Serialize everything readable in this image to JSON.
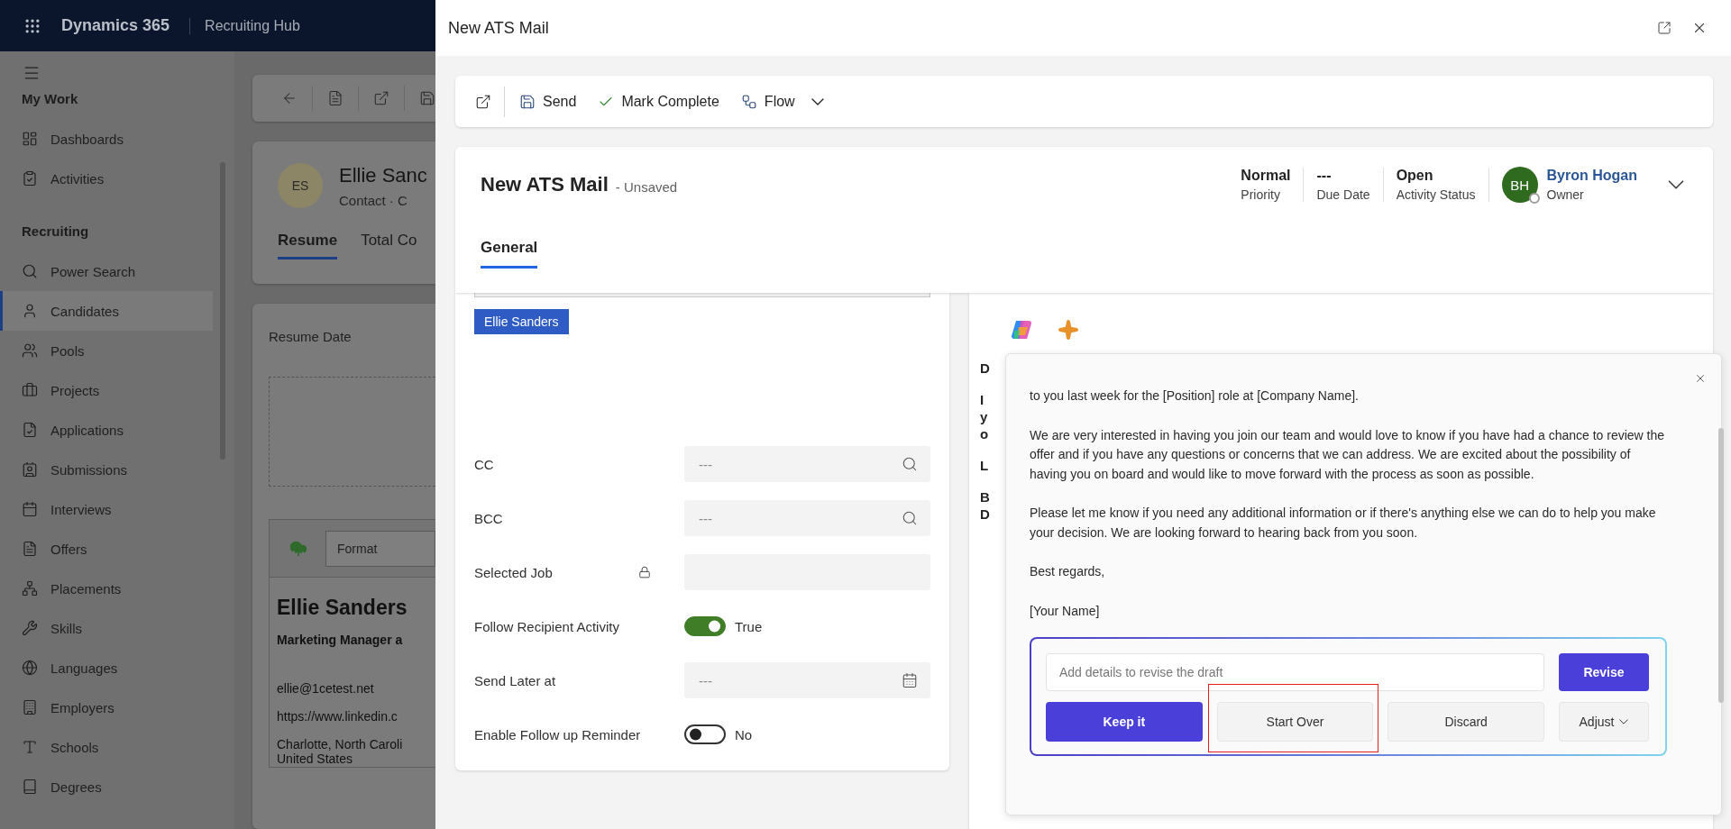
{
  "app_bar": {
    "title": "Dynamics 365",
    "area": "Recruiting Hub"
  },
  "sidebar": {
    "sections": [
      {
        "title": "My Work",
        "items": [
          {
            "label": "Dashboards",
            "selected": false
          },
          {
            "label": "Activities",
            "selected": false
          }
        ]
      },
      {
        "title": "Recruiting",
        "items": [
          {
            "label": "Power Search",
            "selected": false
          },
          {
            "label": "Candidates",
            "selected": true
          },
          {
            "label": "Pools",
            "selected": false
          },
          {
            "label": "Projects",
            "selected": false
          },
          {
            "label": "Applications",
            "selected": false
          },
          {
            "label": "Submissions",
            "selected": false
          },
          {
            "label": "Interviews",
            "selected": false
          },
          {
            "label": "Offers",
            "selected": false
          },
          {
            "label": "Placements",
            "selected": false
          },
          {
            "label": "Skills",
            "selected": false
          },
          {
            "label": "Languages",
            "selected": false
          },
          {
            "label": "Employers",
            "selected": false
          },
          {
            "label": "Schools",
            "selected": false
          },
          {
            "label": "Degrees",
            "selected": false
          }
        ]
      }
    ]
  },
  "background_record": {
    "initials": "ES",
    "name": "Ellie Sanc",
    "subtitle": "Contact · C",
    "tabs": [
      {
        "label": "Resume",
        "selected": true
      },
      {
        "label": "Total Co",
        "selected": false
      }
    ],
    "field_label": "Resume Date",
    "format": "Format",
    "resume_name": "Ellie Sanders",
    "resume_title": "Marketing Manager a",
    "resume_lines": [
      "ellie@1cetest.net",
      "https://www.linkedin.c",
      "Charlotte, North Caroli\nUnited States"
    ]
  },
  "dialog": {
    "title": "New ATS Mail",
    "toolbar": [
      {
        "label": "Send",
        "has_menu": false
      },
      {
        "label": "Mark Complete",
        "has_menu": false
      },
      {
        "label": "Flow",
        "has_menu": true
      }
    ],
    "header": {
      "title": "New ATS Mail",
      "status": "- Unsaved",
      "fields": [
        {
          "value": "Normal",
          "label": "Priority"
        },
        {
          "value": "---",
          "label": "Due Date"
        },
        {
          "value": "Open",
          "label": "Activity Status"
        }
      ],
      "owner": {
        "initials": "BH",
        "name": "Byron Hogan",
        "label": "Owner"
      }
    },
    "tabs": [
      {
        "label": "General",
        "selected": true
      }
    ],
    "recipient_chip": "Ellie Sanders",
    "rows": [
      {
        "kind": "lookup",
        "label": "CC",
        "placeholder": "---"
      },
      {
        "kind": "lookup",
        "label": "BCC",
        "placeholder": "---"
      },
      {
        "kind": "locked",
        "label": "Selected Job"
      },
      {
        "kind": "toggle",
        "label": "Follow Recipient Activity",
        "on": true,
        "value": "True"
      },
      {
        "kind": "date",
        "label": "Send Later at",
        "placeholder": "---"
      },
      {
        "kind": "toggle",
        "label": "Enable Follow up Reminder",
        "on": false,
        "value": "No"
      }
    ],
    "body_fragments": [
      [
        "D"
      ],
      [
        "I",
        "y",
        "o"
      ],
      [
        "L"
      ],
      [
        "B",
        "D"
      ]
    ],
    "draft": {
      "paragraphs": [
        "to you last week for the [Position] role at [Company Name].",
        "We are very interested in having you join our team and would love to know if you have had a chance to review the offer and if you have any questions or concerns that we can address. We are excited about the possibility of having you on board and would like to move forward with the process as soon as possible.",
        "Please let me know if you need any additional information or if there's anything else we can do to help you make your decision. We are looking forward to hearing back from you soon.",
        "Best regards,",
        "[Your Name]"
      ],
      "revise_placeholder": "Add details to revise the draft",
      "revise_button": "Revise",
      "actions": [
        {
          "kind": "primary",
          "label": "Keep it",
          "highlighted": false
        },
        {
          "kind": "secondary",
          "label": "Start Over",
          "highlighted": true
        },
        {
          "kind": "secondary",
          "label": "Discard",
          "highlighted": false
        },
        {
          "kind": "menu",
          "label": "Adjust",
          "highlighted": false
        }
      ]
    }
  }
}
